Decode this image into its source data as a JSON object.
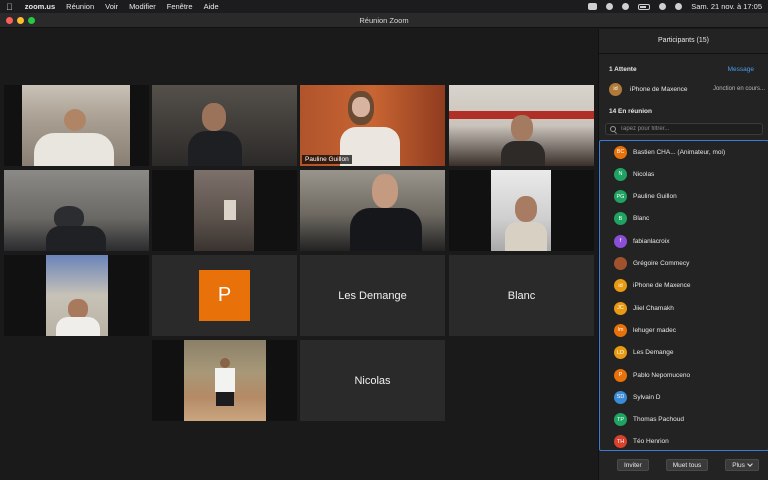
{
  "menubar": {
    "app": "zoom.us",
    "items": [
      "Réunion",
      "Voir",
      "Modifier",
      "Fenêtre",
      "Aide"
    ],
    "datetime": "Sam. 21 nov. à  17:05"
  },
  "window": {
    "title": "Réunion Zoom"
  },
  "gallery": {
    "active_label": "Pauline Guillon",
    "avatar_letter": "P",
    "name_tiles": [
      "Les Demange",
      "Blanc",
      "Nicolas"
    ]
  },
  "panel": {
    "title": "Participants (15)",
    "waiting_header": "1 Attente",
    "message_link": "Message",
    "waiting": {
      "initials": "id",
      "name": "iPhone de Maxence",
      "status": "Jonction en cours...",
      "color": "#b07a3a"
    },
    "in_meeting_header": "14 En réunion",
    "search_placeholder": "Tapez pour filtrer...",
    "participants": [
      {
        "initials": "BC",
        "name": "Bastien CHA...  (Animateur, moi)",
        "color": "#e8710a"
      },
      {
        "initials": "N",
        "name": "Nicolas",
        "color": "#1ea362"
      },
      {
        "initials": "PG",
        "name": "Pauline Guillon",
        "color": "#1ea362"
      },
      {
        "initials": "B",
        "name": "Blanc",
        "color": "#1ea362"
      },
      {
        "initials": "f",
        "name": "fabianlacroix",
        "color": "#8a4fd6"
      },
      {
        "initials": "",
        "name": "Grégoire Commecy",
        "color": "#a0522d"
      },
      {
        "initials": "id",
        "name": "iPhone de Maxence",
        "color": "#e89a12"
      },
      {
        "initials": "JC",
        "name": "Jiiel Chamakh",
        "color": "#e89a12"
      },
      {
        "initials": "lm",
        "name": "lehuger madec",
        "color": "#e8710a"
      },
      {
        "initials": "LD",
        "name": "Les Demange",
        "color": "#e89a12"
      },
      {
        "initials": "P",
        "name": "Pablo Nepomuceno",
        "color": "#e8710a"
      },
      {
        "initials": "SD",
        "name": "Sylvain D",
        "color": "#3a8bd5"
      },
      {
        "initials": "TP",
        "name": "Thomas Pachoud",
        "color": "#1ea362"
      },
      {
        "initials": "TH",
        "name": "Téo Henrion",
        "color": "#d9412c"
      }
    ],
    "footer": {
      "invite": "Inviter",
      "mute_all": "Muet tous",
      "more": "Plus"
    }
  }
}
